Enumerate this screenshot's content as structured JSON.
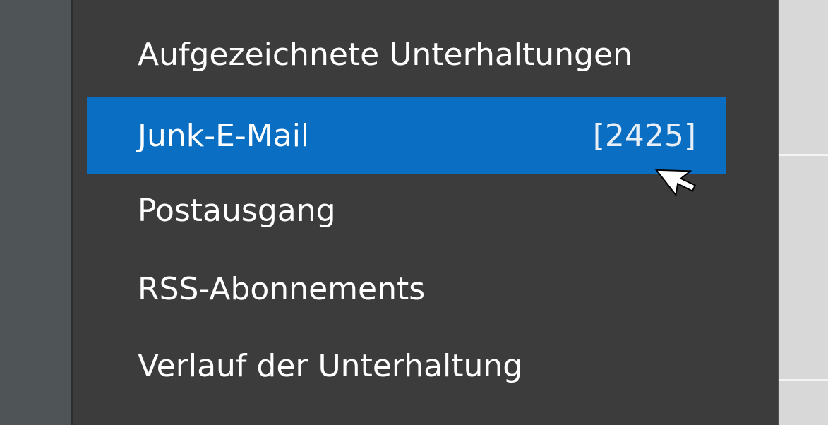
{
  "menu": {
    "items": [
      {
        "label": "Aufgezeichnete Unterhaltungen",
        "count": ""
      },
      {
        "label": "Junk-E-Mail",
        "count": "[2425]"
      },
      {
        "label": "Postausgang",
        "count": ""
      },
      {
        "label": "RSS-Abonnements",
        "count": ""
      },
      {
        "label": "Verlauf der Unterhaltung",
        "count": ""
      }
    ],
    "selected_item": "Junk-E-Mail"
  },
  "colors": {
    "menu_background": "#3c3c3c",
    "selection": "#0a6fc2",
    "text": "#ffffff"
  },
  "icons": [
    "mouse-pointer-icon"
  ]
}
